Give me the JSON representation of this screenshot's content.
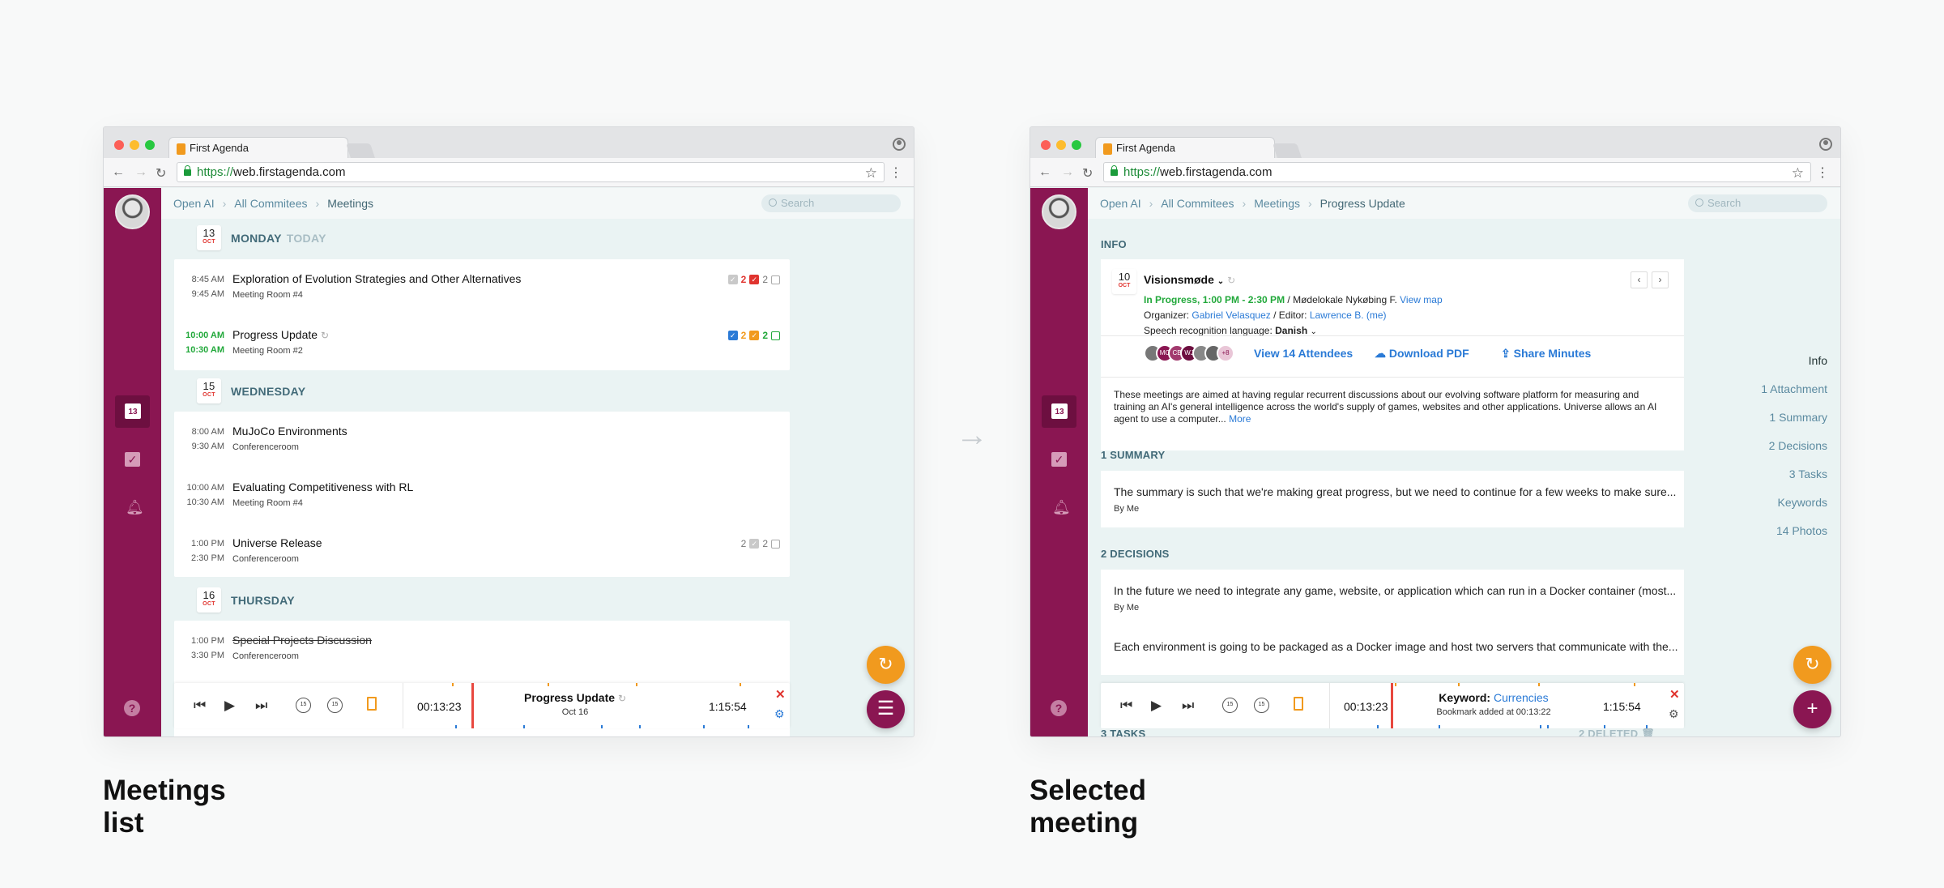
{
  "browser": {
    "tab_title": "First Agenda",
    "url_https": "https://",
    "url_host": "web.firstagenda.com"
  },
  "sidebar": {
    "today_icon_day": "13"
  },
  "arrow": "→",
  "left": {
    "caption": "Meetings list",
    "breadcrumbs": [
      "Open AI",
      "All Commitees",
      "Meetings"
    ],
    "search_placeholder": "Search",
    "days": [
      {
        "day": "13",
        "month": "OCT",
        "label": "MONDAY",
        "today": "TODAY",
        "meetings": [
          {
            "start": "8:45 AM",
            "end": "9:45 AM",
            "title": "Exploration of Evolution Strategies and Other Alternatives",
            "room": "Meeting Room #4",
            "b1": "2",
            "b2": "2"
          },
          {
            "start": "10:00 AM",
            "end": "10:30 AM",
            "title": "Progress Update",
            "room": "Meeting Room #2",
            "b1": "2",
            "b2": "2"
          }
        ]
      },
      {
        "day": "15",
        "month": "OCT",
        "label": "WEDNESDAY",
        "meetings": [
          {
            "start": "8:00 AM",
            "end": "9:30 AM",
            "title": "MuJoCo Environments",
            "room": "Conferenceroom"
          },
          {
            "start": "10:00 AM",
            "end": "10:30 AM",
            "title": "Evaluating Competitiveness with RL",
            "room": "Meeting Room #4"
          },
          {
            "start": "1:00 PM",
            "end": "2:30 PM",
            "title": "Universe Release",
            "room": "Conferenceroom",
            "b1": "2",
            "b2": "2"
          }
        ]
      },
      {
        "day": "16",
        "month": "OCT",
        "label": "THURSDAY",
        "meetings": [
          {
            "start": "1:00 PM",
            "end": "3:30 PM",
            "title": "Special Projects Discussion",
            "room": "Conferenceroom"
          }
        ]
      }
    ],
    "player": {
      "current": "00:13:23",
      "total": "1:15:54",
      "title": "Progress Update",
      "sub": "Oct 16"
    }
  },
  "right": {
    "caption": "Selected meeting",
    "breadcrumbs": [
      "Open AI",
      "All Commitees",
      "Meetings",
      "Progress Update"
    ],
    "search_placeholder": "Search",
    "info_header": "INFO",
    "meeting": {
      "day": "10",
      "month": "OCT",
      "title": "Visionsmøde",
      "status": "In Progress, 1:00 PM - 2:30 PM",
      "location": "/ Mødelokale Nykøbing F.",
      "view_map": "View map",
      "organizer_label": "Organizer:",
      "organizer": "Gabriel Velasquez",
      "editor_label": "/ Editor:",
      "editor": "Lawrence B. (me)",
      "speech_label": "Speech recognition language:",
      "speech_lang": "Danish",
      "avatars": [
        "MC",
        "CB",
        "WJ"
      ],
      "more_count": "+8",
      "view_attendees": "View 14 Attendees",
      "download_pdf": "Download PDF",
      "share_minutes": "Share Minutes",
      "description": "These meetings are aimed at having regular recurrent discussions about our evolving software platform for measuring and training an AI's general intelligence across the world's supply of games, websites and other applications. Universe allows an AI agent to use a computer...",
      "more": "More"
    },
    "summary_header": "1 SUMMARY",
    "summary_text": "The summary is such that we're making great progress, but we need to continue for a few weeks to make sure...",
    "summary_by": "By Me",
    "decisions_header": "2 DECISIONS",
    "decision_1": "In the future we need to integrate any game, website, or application which can run in a Docker container (most...",
    "decision_1_by": "By Me",
    "decision_2": "Each environment is going to be packaged as a Docker image and host two servers that communicate with the...",
    "tasks_header": "3 TASKS",
    "deleted_label": "2 DELETED",
    "toc": [
      "Info",
      "1 Attachment",
      "1 Summary",
      "2 Decisions",
      "3 Tasks",
      "Keywords",
      "14 Photos"
    ],
    "player": {
      "current": "00:13:23",
      "total": "1:15:54",
      "keyword_label": "Keyword:",
      "keyword": "Currencies",
      "bookmark": "Bookmark added at 00:13:22"
    }
  },
  "player_controls": {
    "skip_back": "15",
    "skip_fwd": "15"
  },
  "colors": {
    "rail": "#8a1652",
    "accent_orange": "#f19a1e",
    "link_blue": "#2a7ad6",
    "status_green": "#21a83a",
    "danger_red": "#e0342f"
  }
}
